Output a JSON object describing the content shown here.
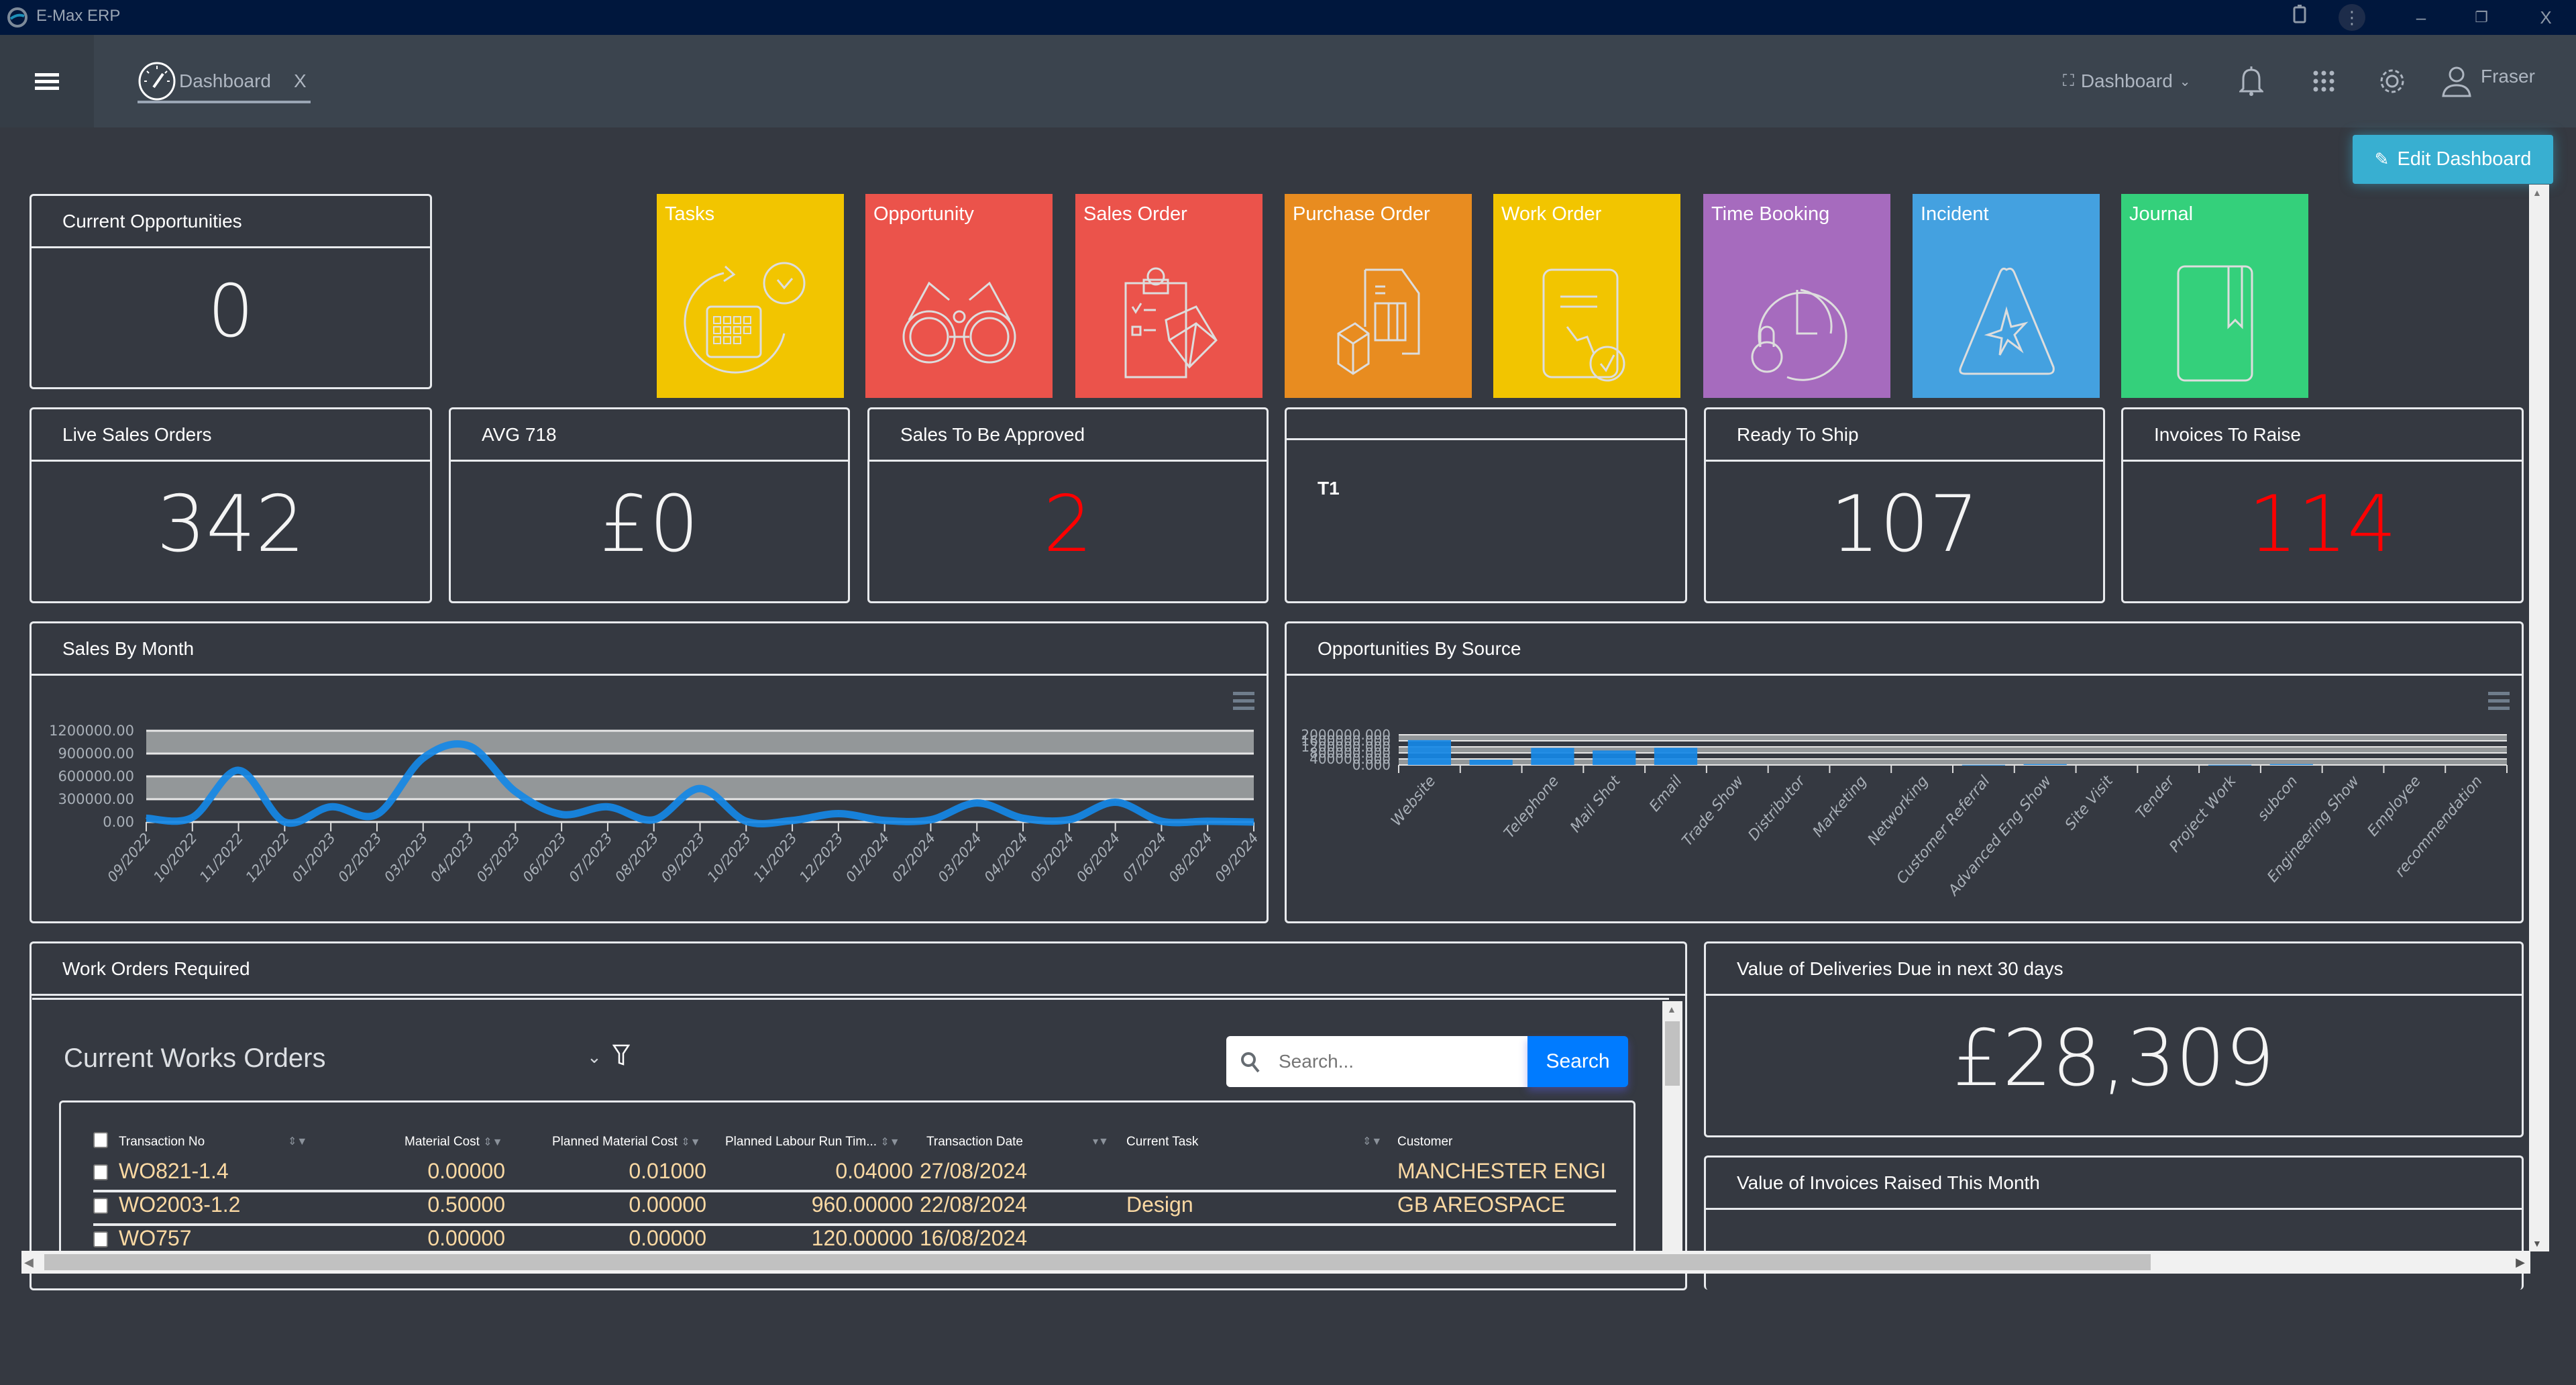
{
  "window": {
    "app_title": "E-Max ERP",
    "controls": [
      "extensions-icon",
      "more-icon",
      "minimize-icon",
      "restore-icon",
      "close-icon"
    ]
  },
  "nav": {
    "tab": {
      "label": "Dashboard",
      "close": "X"
    },
    "dashboard_menu": "Dashboard",
    "user": "Fraser"
  },
  "toolbar": {
    "edit_dashboard": "Edit Dashboard"
  },
  "cards": {
    "current_opportunities": {
      "title": "Current Opportunities",
      "value": "0"
    },
    "live_sales_orders": {
      "title": "Live Sales Orders",
      "value": "342"
    },
    "avg": {
      "title": "AVG 718",
      "value": "£0"
    },
    "sales_to_be_approved": {
      "title": "Sales To Be Approved",
      "value": "2",
      "color": "#ff0000"
    },
    "t1": {
      "title": "",
      "body": "T1"
    },
    "ready_to_ship": {
      "title": "Ready To Ship",
      "value": "107"
    },
    "invoices_to_raise": {
      "title": "Invoices To Raise",
      "value": "114",
      "color": "#ff0000"
    },
    "deliveries_due": {
      "title": "Value of Deliveries Due in next 30 days",
      "value": "£28,309"
    },
    "invoices_raised": {
      "title": "Value of Invoices Raised This Month",
      "value": ""
    }
  },
  "tiles": [
    {
      "label": "Tasks",
      "color": "#f2c500",
      "icon": "tasks-calendar-icon"
    },
    {
      "label": "Opportunity",
      "color": "#eb534b",
      "icon": "binoculars-icon"
    },
    {
      "label": "Sales Order",
      "color": "#eb534b",
      "icon": "clipboard-box-icon"
    },
    {
      "label": "Purchase Order",
      "color": "#e88c20",
      "icon": "document-box-icon"
    },
    {
      "label": "Work Order",
      "color": "#f2c500",
      "icon": "work-order-wrench-icon"
    },
    {
      "label": "Time Booking",
      "color": "#a66bbe",
      "icon": "clock-lock-icon"
    },
    {
      "label": "Incident",
      "color": "#44a1e0",
      "icon": "warning-triangle-icon"
    },
    {
      "label": "Journal",
      "color": "#34d07b",
      "icon": "journal-bookmark-icon"
    }
  ],
  "sales_chart_panel": {
    "title": "Sales By Month"
  },
  "opps_chart_panel": {
    "title": "Opportunities By Source"
  },
  "chart_data": [
    {
      "type": "line",
      "title": "Sales By Month",
      "xlabel": "",
      "ylabel": "",
      "categories": [
        "09/2022",
        "10/2022",
        "11/2022",
        "12/2022",
        "01/2023",
        "02/2023",
        "03/2023",
        "04/2023",
        "05/2023",
        "06/2023",
        "07/2023",
        "08/2023",
        "09/2023",
        "10/2023",
        "11/2023",
        "12/2023",
        "01/2024",
        "02/2024",
        "03/2024",
        "04/2024",
        "05/2024",
        "06/2024",
        "07/2024",
        "08/2024",
        "09/2024"
      ],
      "series": [
        {
          "name": "Sales",
          "color": "#1588e6",
          "values": [
            50000,
            60000,
            680000,
            0,
            200000,
            100000,
            840000,
            1000000,
            400000,
            100000,
            200000,
            30000,
            440000,
            10000,
            20000,
            110000,
            20000,
            30000,
            250000,
            50000,
            30000,
            260000,
            10000,
            10000,
            0
          ]
        }
      ],
      "yticks": [
        "0.00",
        "300000.00",
        "600000.00",
        "900000.00",
        "1200000.00"
      ],
      "ylim": [
        0,
        1200000
      ],
      "grid": true,
      "legend": "none"
    },
    {
      "type": "bar",
      "title": "Opportunities By Source",
      "xlabel": "",
      "ylabel": "",
      "categories": [
        "Website",
        "",
        "Telephone",
        "Mail Shot",
        "Email",
        "Trade Show",
        "Distributor",
        "Marketing",
        "Networking",
        "Customer Referral",
        "Advanced Eng Show",
        "Site Visit",
        "Tender",
        "Project Work",
        "subcon",
        "Engineering Show",
        "Employee",
        "recommendation"
      ],
      "values": [
        1650000,
        350000,
        1130000,
        960000,
        1140000,
        0,
        0,
        0,
        0,
        10000,
        60000,
        0,
        0,
        10000,
        60000,
        0,
        0,
        0
      ],
      "yticks": [
        "0.000",
        "400000.000",
        "800000.000",
        "1200000.000",
        "1600000.000",
        "2000000.000"
      ],
      "ylim": [
        0,
        2000000
      ],
      "grid": true,
      "legend": "none",
      "color": "#1588e6"
    }
  ],
  "work_orders": {
    "panel_title": "Work Orders Required",
    "view_name": "Current Works Orders",
    "search_placeholder": "Search...",
    "search_button": "Search",
    "columns": [
      "Transaction No",
      "Material Cost",
      "Planned Material Cost",
      "Planned Labour Run Tim...",
      "Transaction Date",
      "Current Task",
      "Customer"
    ],
    "rows": [
      {
        "transaction_no": "WO821-1.4",
        "material_cost": "0.00000",
        "planned_material_cost": "0.01000",
        "planned_labour": "0.04000",
        "date": "27/08/2024",
        "task": "",
        "customer": "MANCHESTER ENGII"
      },
      {
        "transaction_no": "WO2003-1.2",
        "material_cost": "0.50000",
        "planned_material_cost": "0.00000",
        "planned_labour": "960.00000",
        "date": "22/08/2024",
        "task": "Design",
        "customer": "GB AREOSPACE"
      },
      {
        "transaction_no": "WO757",
        "material_cost": "0.00000",
        "planned_material_cost": "0.00000",
        "planned_labour": "120.00000",
        "date": "16/08/2024",
        "task": "",
        "customer": ""
      }
    ]
  }
}
